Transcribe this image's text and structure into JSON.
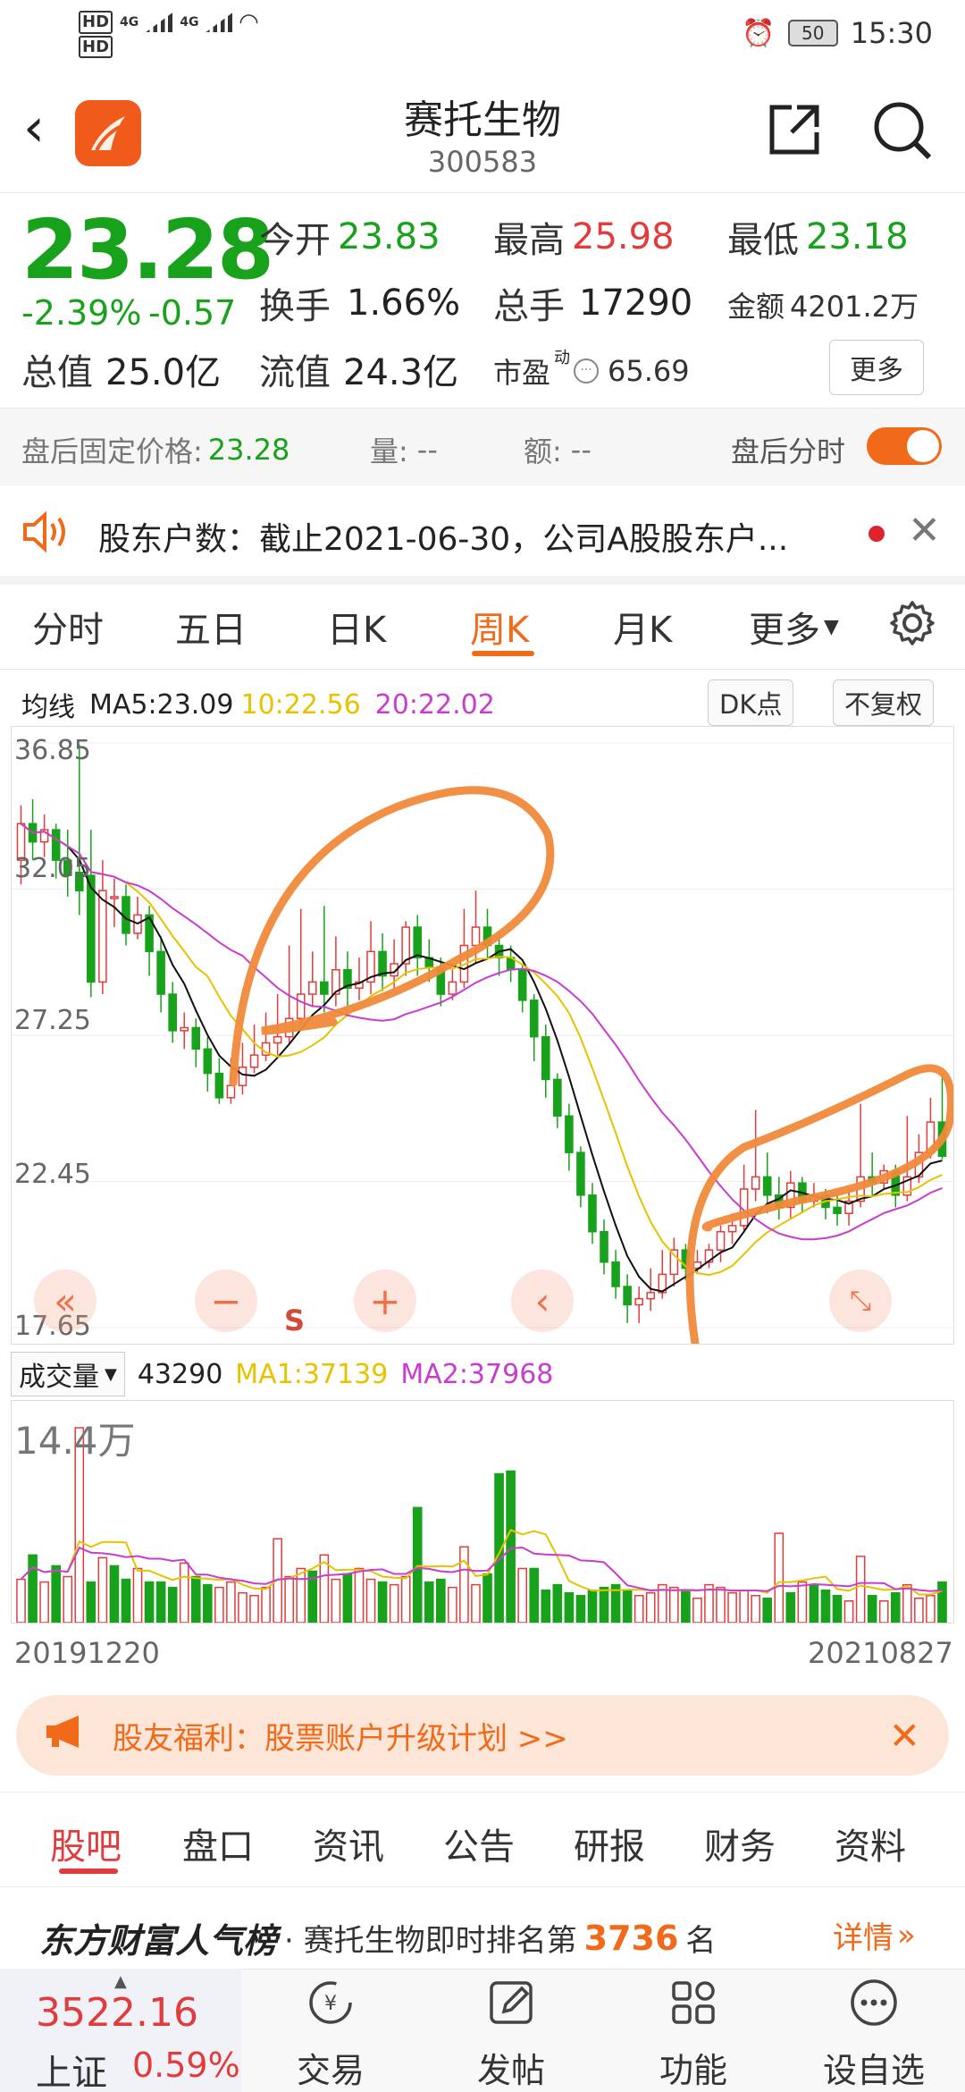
{
  "status_bar": {
    "network": "HD 4G 4G",
    "battery": "50",
    "time": "15:30"
  },
  "header": {
    "title": "赛托生物",
    "code": "300583"
  },
  "quote": {
    "price": "23.28",
    "change_pct": "-2.39%",
    "change": "-0.57",
    "open_label": "今开",
    "open": "23.83",
    "high_label": "最高",
    "high": "25.98",
    "low_label": "最低",
    "low": "23.18",
    "turnover_label": "换手",
    "turnover": "1.66%",
    "volume_label": "总手",
    "volume": "17290",
    "amount_label": "金额",
    "amount": "4201.2万",
    "mktcap_label": "总值",
    "mktcap": "25.0亿",
    "float_label": "流值",
    "float": "24.3亿",
    "pe_label": "市盈",
    "pe_sup": "动",
    "pe": "65.69",
    "more": "更多"
  },
  "after_hours": {
    "price_label": "盘后固定价格:",
    "price": "23.28",
    "vol_label": "量:",
    "vol": "--",
    "amt_label": "额:",
    "amt": "--",
    "toggle_label": "盘后分时"
  },
  "notice": {
    "text": "股东户数：截止2021-06-30，公司A股股东户..."
  },
  "chart_tabs": [
    "分时",
    "五日",
    "日K",
    "周K",
    "月K",
    "更多"
  ],
  "ma_bar": {
    "label": "均线",
    "ma5": "MA5:23.09",
    "ma10": "10:22.56",
    "ma20": "20:22.02",
    "dk": "DK点",
    "adjust": "不复权"
  },
  "colors": {
    "up": "#e23b3b",
    "down": "#18a21c",
    "accent": "#f06a1a",
    "ma5": "#111111",
    "ma10": "#e6c200",
    "ma20": "#c83ccf"
  },
  "chart_data": {
    "type": "candlestick",
    "period": "weekly",
    "ylim": [
      17.65,
      36.85
    ],
    "y_ticks": [
      "36.85",
      "32.05",
      "27.25",
      "22.45",
      "17.65"
    ],
    "x_labels": [
      "20191220",
      "20210827"
    ],
    "candles": [
      [
        33.0,
        34.2,
        34.8,
        32.2
      ],
      [
        34.2,
        33.6,
        35.0,
        33.0
      ],
      [
        33.6,
        34.0,
        34.5,
        33.1
      ],
      [
        34.0,
        33.0,
        34.2,
        32.4
      ],
      [
        33.0,
        32.5,
        34.0,
        31.8
      ],
      [
        32.6,
        32.0,
        36.8,
        31.2
      ],
      [
        32.5,
        29.0,
        34.0,
        28.5
      ],
      [
        29.0,
        32.0,
        33.0,
        28.6
      ],
      [
        31.8,
        31.8,
        32.4,
        30.8
      ],
      [
        31.8,
        30.6,
        32.2,
        30.2
      ],
      [
        30.6,
        31.2,
        31.8,
        30.4
      ],
      [
        31.2,
        30.0,
        31.5,
        29.2
      ],
      [
        30.0,
        28.6,
        30.5,
        28.0
      ],
      [
        28.6,
        27.4,
        29.0,
        27.0
      ],
      [
        27.4,
        27.5,
        28.0,
        26.8
      ],
      [
        27.5,
        26.8,
        27.8,
        26.2
      ],
      [
        26.8,
        26.0,
        27.2,
        25.4
      ],
      [
        26.0,
        25.2,
        26.5,
        25.0
      ],
      [
        25.2,
        25.6,
        26.5,
        25.0
      ],
      [
        25.6,
        26.2,
        27.0,
        25.3
      ],
      [
        26.2,
        26.6,
        27.6,
        26.0
      ],
      [
        26.6,
        27.0,
        28.0,
        26.4
      ],
      [
        27.0,
        27.2,
        28.6,
        26.6
      ],
      [
        27.2,
        27.8,
        30.2,
        27.0
      ],
      [
        27.8,
        28.6,
        31.4,
        27.6
      ],
      [
        28.6,
        29.0,
        30.0,
        28.2
      ],
      [
        29.0,
        28.6,
        31.5,
        28.0
      ],
      [
        28.6,
        29.4,
        30.5,
        28.2
      ],
      [
        29.4,
        28.8,
        30.0,
        28.2
      ],
      [
        28.8,
        29.0,
        29.8,
        28.4
      ],
      [
        29.0,
        30.0,
        31.0,
        28.6
      ],
      [
        30.0,
        29.2,
        30.6,
        28.7
      ],
      [
        29.2,
        29.6,
        30.4,
        28.8
      ],
      [
        29.6,
        30.8,
        31.0,
        29.2
      ],
      [
        30.8,
        29.8,
        31.2,
        29.2
      ],
      [
        29.8,
        29.5,
        30.4,
        29.0
      ],
      [
        29.5,
        28.6,
        29.8,
        28.2
      ],
      [
        28.6,
        29.0,
        29.4,
        28.4
      ],
      [
        29.0,
        30.2,
        31.4,
        28.8
      ],
      [
        30.2,
        30.8,
        32.0,
        29.6
      ],
      [
        30.8,
        30.2,
        31.4,
        29.8
      ],
      [
        30.2,
        29.8,
        30.6,
        29.2
      ],
      [
        29.8,
        29.4,
        30.2,
        29.0
      ],
      [
        29.4,
        28.4,
        29.6,
        28.0
      ],
      [
        28.4,
        27.2,
        28.6,
        26.4
      ],
      [
        27.2,
        25.8,
        27.6,
        25.2
      ],
      [
        25.8,
        24.6,
        26.0,
        24.2
      ],
      [
        24.6,
        23.4,
        25.0,
        22.8
      ],
      [
        23.4,
        22.0,
        23.6,
        21.6
      ],
      [
        22.0,
        20.8,
        22.4,
        20.4
      ],
      [
        20.8,
        19.8,
        21.2,
        19.4
      ],
      [
        19.8,
        19.0,
        20.2,
        18.6
      ],
      [
        19.0,
        18.4,
        19.4,
        17.8
      ],
      [
        18.4,
        18.6,
        19.0,
        17.8
      ],
      [
        18.6,
        18.8,
        19.6,
        18.2
      ],
      [
        18.8,
        19.4,
        20.2,
        18.6
      ],
      [
        19.4,
        20.2,
        20.6,
        19.0
      ],
      [
        20.2,
        19.6,
        20.4,
        19.2
      ],
      [
        19.6,
        19.8,
        20.2,
        19.4
      ],
      [
        19.8,
        20.2,
        20.4,
        19.6
      ],
      [
        20.2,
        20.8,
        21.0,
        19.8
      ],
      [
        20.8,
        21.0,
        21.4,
        20.4
      ],
      [
        21.0,
        22.2,
        23.0,
        20.8
      ],
      [
        22.2,
        22.6,
        24.8,
        21.8
      ],
      [
        22.6,
        22.0,
        23.4,
        21.4
      ],
      [
        22.0,
        21.6,
        22.6,
        21.2
      ],
      [
        21.6,
        22.4,
        22.8,
        21.2
      ],
      [
        22.4,
        21.8,
        22.6,
        21.4
      ],
      [
        21.8,
        22.0,
        22.4,
        21.6
      ],
      [
        22.0,
        21.6,
        22.2,
        21.2
      ],
      [
        21.6,
        21.4,
        22.0,
        21.0
      ],
      [
        21.4,
        21.8,
        22.2,
        21.0
      ],
      [
        21.8,
        22.6,
        25.0,
        21.6
      ],
      [
        22.6,
        22.4,
        23.4,
        22.0
      ],
      [
        22.4,
        22.8,
        23.0,
        22.2
      ],
      [
        22.8,
        22.0,
        23.0,
        21.6
      ],
      [
        22.0,
        22.6,
        24.6,
        21.8
      ],
      [
        22.6,
        23.4,
        24.0,
        22.4
      ],
      [
        23.4,
        24.4,
        25.2,
        23.2
      ],
      [
        24.4,
        23.28,
        25.98,
        23.18
      ]
    ],
    "ma": {
      "ma5": "MA5:23.09",
      "ma10": "10:22.56",
      "ma20": "20:22.02"
    },
    "volume": {
      "label": "成交量",
      "value": "43290",
      "ma1": "MA1:37139",
      "ma2": "MA2:37968",
      "ylabel": "14.4万",
      "bars": [
        3.2,
        5.0,
        3.0,
        4.2,
        3.4,
        14.4,
        3.0,
        4.8,
        4.2,
        3.2,
        4.0,
        3.0,
        3.0,
        2.6,
        4.4,
        3.4,
        2.8,
        2.6,
        3.0,
        2.2,
        2.0,
        2.6,
        6.2,
        3.4,
        4.0,
        3.8,
        5.0,
        3.2,
        3.6,
        4.0,
        3.2,
        3.0,
        2.8,
        3.4,
        8.5,
        3.0,
        3.2,
        2.6,
        5.6,
        2.8,
        3.6,
        11.0,
        11.2,
        4.0,
        4.0,
        2.4,
        2.8,
        2.2,
        2.0,
        2.4,
        2.6,
        2.8,
        2.4,
        2.0,
        2.2,
        2.8,
        2.6,
        2.4,
        1.8,
        2.8,
        2.6,
        2.2,
        2.4,
        2.0,
        1.8,
        6.6,
        2.2,
        3.0,
        2.8,
        2.4,
        2.0,
        1.6,
        4.9,
        2.0,
        1.6,
        2.2,
        2.8,
        1.8,
        2.0,
        3.0
      ],
      "up": [
        1,
        0,
        1,
        0,
        1,
        1,
        0,
        1,
        0,
        0,
        1,
        0,
        0,
        0,
        1,
        0,
        0,
        1,
        1,
        1,
        1,
        1,
        1,
        1,
        1,
        0,
        1,
        1,
        0,
        1,
        1,
        0,
        1,
        1,
        0,
        0,
        0,
        1,
        1,
        1,
        0,
        0,
        0,
        1,
        0,
        0,
        0,
        0,
        0,
        0,
        0,
        0,
        0,
        1,
        1,
        1,
        1,
        0,
        1,
        1,
        1,
        1,
        1,
        1,
        0,
        1,
        0,
        1,
        0,
        0,
        0,
        1,
        1,
        0,
        1,
        0,
        1,
        1,
        1,
        0
      ]
    }
  },
  "controls": {
    "s_label": "S"
  },
  "banner": {
    "text": "股友福利：股票账户升级计划 >>"
  },
  "bottom_tabs": [
    "股吧",
    "盘口",
    "资讯",
    "公告",
    "研报",
    "财务",
    "资料"
  ],
  "ranking": {
    "brand": "东方财富人气榜",
    "text_pre": "· 赛托生物即时排名第",
    "rank": "3736",
    "text_post": "名",
    "detail": "详情"
  },
  "bottom_nav": {
    "index_value": "3522.16",
    "index_name": "上证",
    "index_change": "0.59%",
    "items": [
      "交易",
      "发帖",
      "功能",
      "设自选"
    ]
  }
}
